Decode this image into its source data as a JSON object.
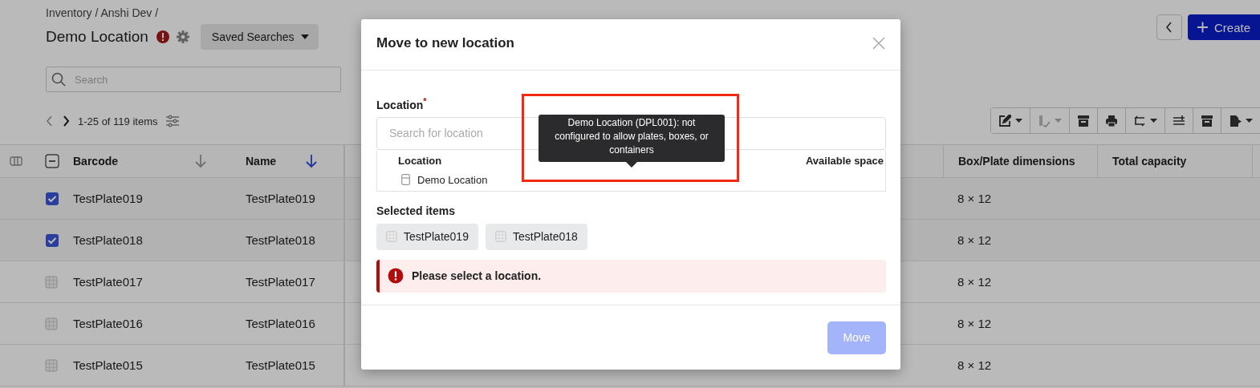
{
  "breadcrumb": "Inventory / Anshi Dev /",
  "page_title": "Demo Location",
  "saved_searches": "Saved Searches",
  "create_button": "Create",
  "search": {
    "placeholder": "Search"
  },
  "pagination": "1-25 of 119 items",
  "toolbar": [
    {
      "menu": true,
      "disabled": false
    },
    {
      "menu": true,
      "disabled": true
    },
    {
      "menu": false,
      "disabled": false
    },
    {
      "menu": false,
      "disabled": false
    },
    {
      "menu": true,
      "disabled": false
    },
    {
      "menu": false,
      "disabled": false
    },
    {
      "menu": false,
      "disabled": false
    },
    {
      "menu": true,
      "disabled": false
    }
  ],
  "table": {
    "select_all_partial": true,
    "columns": [
      {
        "label": "Barcode",
        "sort_active": false
      },
      {
        "label": "Name",
        "sort_active": true
      },
      {
        "label": "Box/Plate dimensions"
      },
      {
        "label": "Total capacity"
      }
    ],
    "rows": [
      {
        "barcode": "TestPlate019",
        "name": "TestPlate019",
        "dimensions": "8 × 12",
        "selected": true
      },
      {
        "barcode": "TestPlate018",
        "name": "TestPlate018",
        "dimensions": "8 × 12",
        "selected": true
      },
      {
        "barcode": "TestPlate017",
        "name": "TestPlate017",
        "dimensions": "8 × 12",
        "selected": false
      },
      {
        "barcode": "TestPlate016",
        "name": "TestPlate016",
        "dimensions": "8 × 12",
        "selected": false
      },
      {
        "barcode": "TestPlate015",
        "name": "TestPlate015",
        "dimensions": "8 × 12",
        "selected": false
      }
    ]
  },
  "modal": {
    "title": "Move to new location",
    "location_label": "Location",
    "required_mark": "*",
    "location_placeholder": "Search for location",
    "results_columns": [
      "Location",
      "Available space"
    ],
    "results": [
      {
        "name": "Demo Location"
      }
    ],
    "selected_label": "Selected items",
    "chips": [
      "TestPlate019",
      "TestPlate018"
    ],
    "alert": "Please select a location.",
    "move_button": {
      "label": "Move",
      "disabled": true
    }
  },
  "tooltip": {
    "text": "Demo Location (DPL001): not configured to allow plates, boxes, or containers"
  }
}
